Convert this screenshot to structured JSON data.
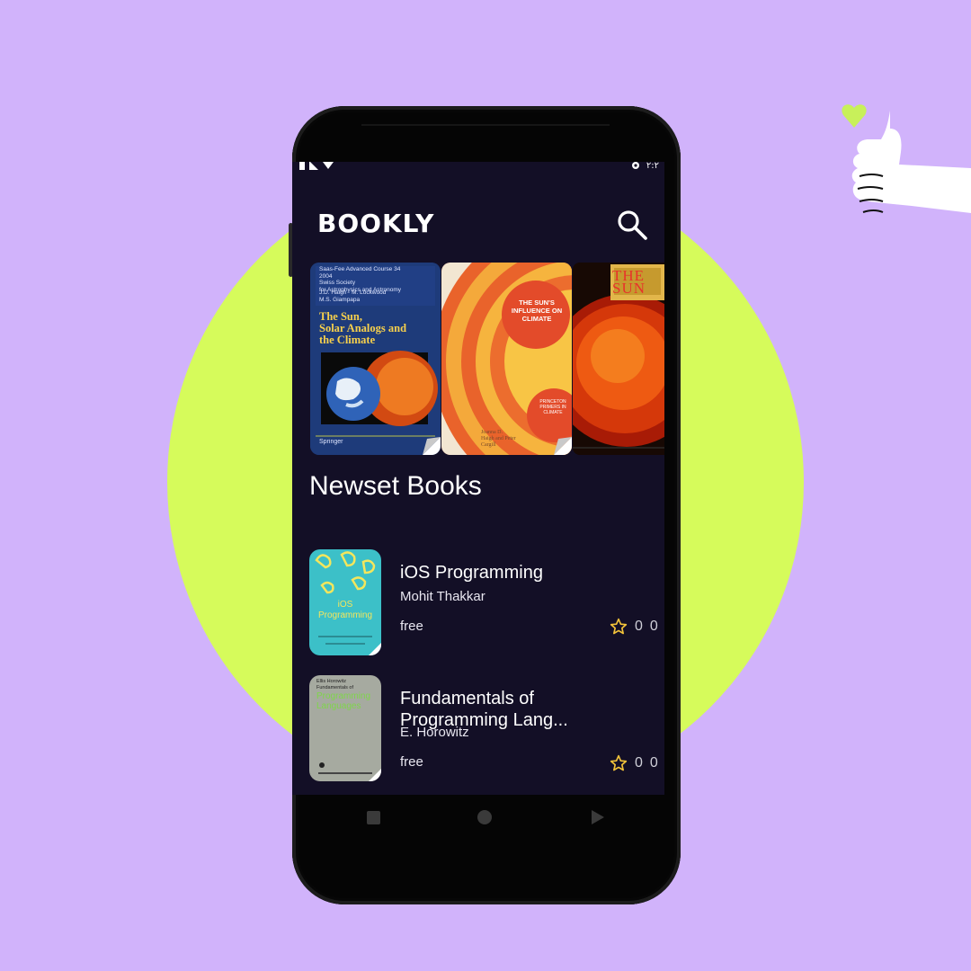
{
  "app": {
    "logo": "BOOKLY"
  },
  "status_bar": {
    "time": "٢:٢"
  },
  "icons": {
    "search": "search-icon",
    "star": "star-outline-icon",
    "nav_recents": "square-icon",
    "nav_home": "circle-icon",
    "nav_back": "triangle-icon"
  },
  "featured_books": [
    {
      "series": "Saas-Fee Advanced Course 34\n2004\nSwiss Society\nfor Astrophysics and Astronomy",
      "authors": "J.D. Haigh · M. Lockwood\nM.S. Giampapa",
      "title": "The Sun,\nSolar Analogs and\nthe Climate",
      "publisher": "Springer"
    },
    {
      "title": "THE SUN'S INFLUENCE ON CLIMATE",
      "series_label": "PRINCETON PRIMERS IN CLIMATE",
      "authors": "Joanna D. Haigh and Peter Cargill"
    },
    {
      "title": "THE SUN"
    }
  ],
  "section": {
    "title": "Newset Books"
  },
  "books": [
    {
      "title": "iOS Programming",
      "author": "Mohit Thakkar",
      "price": "free",
      "rating": "0",
      "count": "0",
      "cover_text": "iOS Programming"
    },
    {
      "title": "Fundamentals of Programming Lang...",
      "author": "E. Horowitz",
      "price": "free",
      "rating": "0",
      "count": "0",
      "cover_author": "Ellis Horowitz",
      "cover_subtitle": "Fundamentals of",
      "cover_text": "Programming Languages"
    }
  ],
  "colors": {
    "background": "#d1b3fb",
    "blob": "#d6fb5b",
    "screen": "#130f26",
    "star": "#f3c33a"
  }
}
